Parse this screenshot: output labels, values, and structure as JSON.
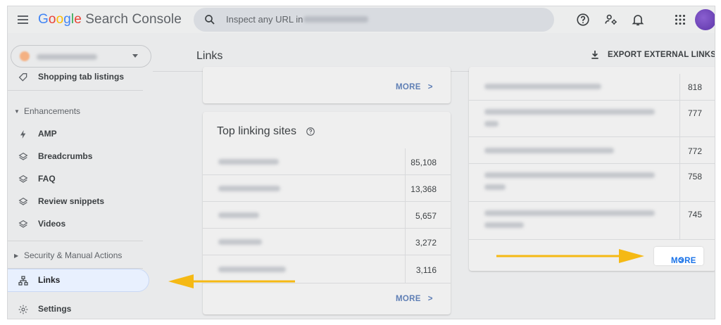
{
  "app": {
    "logo_letters": [
      "G",
      "o",
      "o",
      "g",
      "l",
      "e"
    ],
    "logo_rest": " Search Console"
  },
  "search": {
    "placeholder": "Inspect any URL in"
  },
  "sidebar": {
    "items": [
      {
        "label": "Shopping tab listings",
        "icon": "tag-icon"
      },
      {
        "label": "Enhancements",
        "type": "section"
      },
      {
        "label": "AMP",
        "icon": "bolt-icon"
      },
      {
        "label": "Breadcrumbs",
        "icon": "layers-icon"
      },
      {
        "label": "FAQ",
        "icon": "layers-icon"
      },
      {
        "label": "Review snippets",
        "icon": "layers-icon"
      },
      {
        "label": "Videos",
        "icon": "layers-icon"
      },
      {
        "label": "Security & Manual Actions",
        "type": "section"
      },
      {
        "label": "Links",
        "icon": "sitemap-icon",
        "active": true
      },
      {
        "label": "Settings",
        "icon": "gear-icon"
      }
    ]
  },
  "main": {
    "title": "Links",
    "export_label": "EXPORT EXTERNAL LINKS",
    "top_card": {
      "more_label": "MORE"
    },
    "top_linking_sites": {
      "title": "Top linking sites",
      "rows": [
        {
          "value": "85,108"
        },
        {
          "value": "13,368"
        },
        {
          "value": "5,657"
        },
        {
          "value": "3,272"
        },
        {
          "value": "3,116"
        }
      ],
      "more_label": "MORE"
    },
    "right_card": {
      "rows": [
        {
          "value": "818"
        },
        {
          "value": "777"
        },
        {
          "value": "772"
        },
        {
          "value": "758"
        },
        {
          "value": "745"
        }
      ],
      "more_label": "MORE"
    }
  },
  "colors": {
    "accent": "#1a73e8",
    "arrow": "#f5b914",
    "active_nav_bg": "#e8f0fe"
  }
}
